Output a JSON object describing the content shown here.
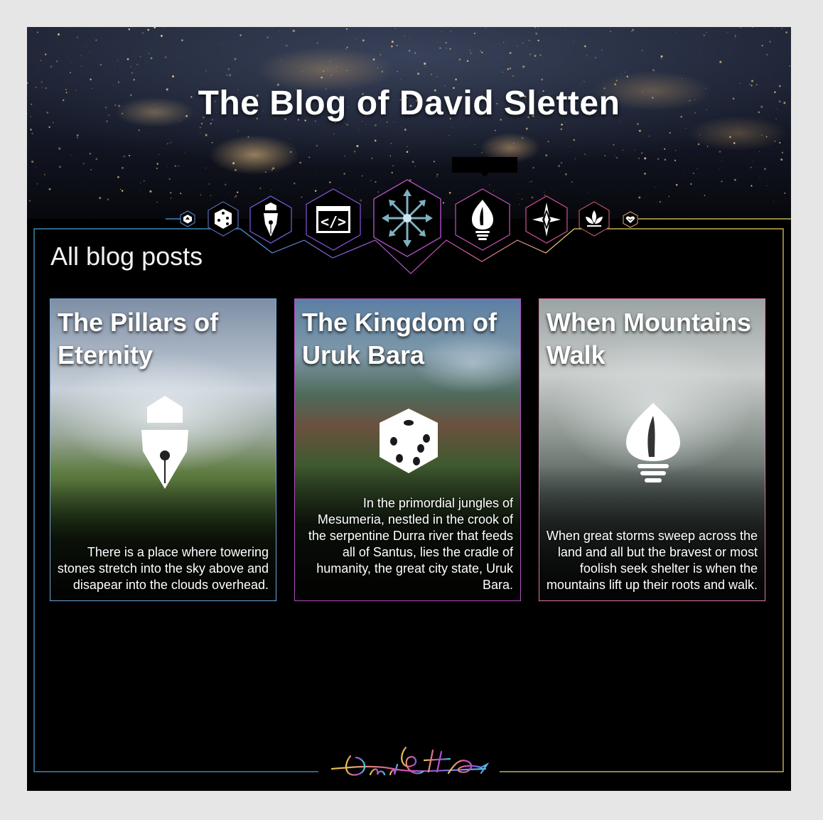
{
  "site": {
    "title": "The Blog of David Sletten"
  },
  "nav": {
    "icons": [
      "d20-icon",
      "die-icon",
      "fountain-pen-icon",
      "code-icon",
      "chaos-star-icon",
      "flame-bulb-icon",
      "compass-star-icon",
      "lotus-icon",
      "heart-hands-icon"
    ]
  },
  "section": {
    "title": "All blog posts"
  },
  "posts": [
    {
      "title": "The Pillars of Eternity",
      "excerpt": "There is a place where towering stones stretch into the sky above and disapear into the clouds overhead.",
      "icon": "fountain-pen-icon"
    },
    {
      "title": "The Kingdom of Uruk Bara",
      "excerpt": "In the primordial jungles of Mesumeria, nestled in the crook of the serpentine Durra river that feeds all of Santus, lies the cradle of humanity, the great city state, Uruk Bara.",
      "icon": "die-icon"
    },
    {
      "title": "When Mountains Walk",
      "excerpt": "When great storms sweep across the land and all but the bravest or most foolish seek shelter  is when the mountains lift up their roots and walk.",
      "icon": "flame-bulb-icon"
    }
  ],
  "footer": {
    "signature_icon": "signature-logo"
  },
  "colors": {
    "background": "#000000",
    "page_outer": "#e6e6e6",
    "frame_blue": "#4aa3df",
    "frame_purple": "#9b59d6",
    "frame_pink": "#d64fa8",
    "frame_yellow": "#e8d36a"
  }
}
